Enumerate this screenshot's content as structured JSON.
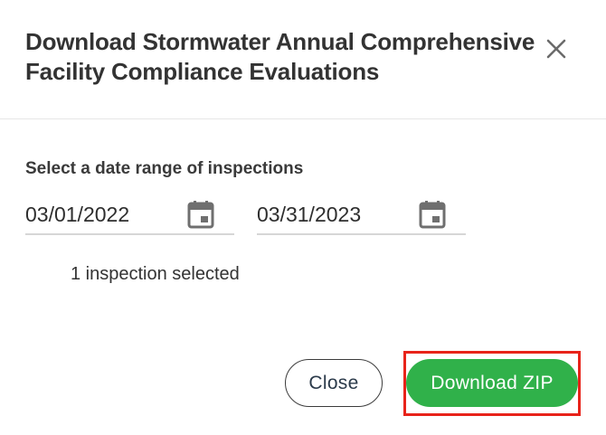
{
  "dialog": {
    "title": "Download Stormwater Annual Comprehensive Facility Compliance Evaluations",
    "close_icon": "close-icon"
  },
  "form": {
    "range_label": "Select a date range of inspections",
    "start_date": "03/01/2022",
    "end_date": "03/31/2023",
    "calendar_icon": "calendar-icon"
  },
  "selection": {
    "count_text": "1 inspection selected"
  },
  "actions": {
    "close_label": "Close",
    "download_label": "Download ZIP"
  },
  "colors": {
    "primary": "#30b14a",
    "highlight": "#e8231a",
    "text": "#333333"
  }
}
